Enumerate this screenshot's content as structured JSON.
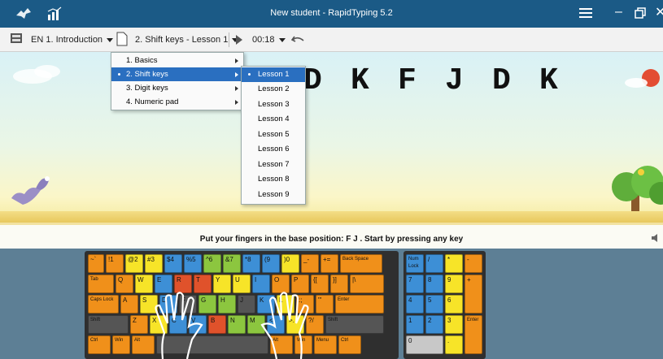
{
  "window": {
    "title": "New student - RapidTyping 5.2"
  },
  "toolbar": {
    "course": "EN 1. Introduction",
    "lesson": "2. Shift keys - Lesson 1",
    "timer": "00:18"
  },
  "menu_sections": {
    "items": [
      {
        "label": "1. Basics",
        "selected": false
      },
      {
        "label": "2. Shift keys",
        "selected": true
      },
      {
        "label": "3. Digit keys",
        "selected": false
      },
      {
        "label": "4. Numeric pad",
        "selected": false
      }
    ]
  },
  "menu_lessons": {
    "items": [
      {
        "label": "Lesson 1",
        "selected": true
      },
      {
        "label": "Lesson 2",
        "selected": false
      },
      {
        "label": "Lesson 3",
        "selected": false
      },
      {
        "label": "Lesson 4",
        "selected": false
      },
      {
        "label": "Lesson 5",
        "selected": false
      },
      {
        "label": "Lesson 6",
        "selected": false
      },
      {
        "label": "Lesson 7",
        "selected": false
      },
      {
        "label": "Lesson 8",
        "selected": false
      },
      {
        "label": "Lesson 9",
        "selected": false
      }
    ]
  },
  "exercise": {
    "letters": [
      "F",
      "J",
      "D",
      "K",
      "F",
      "J",
      "D",
      "K"
    ]
  },
  "instruction": "Put your fingers in the base position:  F  J .  Start by pressing any key",
  "keyboard": {
    "rows": [
      [
        "~`",
        "!1",
        "@2",
        "#3",
        "$4",
        "%5",
        "^6",
        "&7",
        "*8",
        "(9",
        ")0",
        "_-",
        "+=",
        "Back Space"
      ],
      [
        "Tab",
        "Q",
        "W",
        "E",
        "R",
        "T",
        "Y",
        "U",
        "I",
        "O",
        "P",
        "{[",
        "}]",
        "|\\"
      ],
      [
        "Caps Lock",
        "A",
        "S",
        "D",
        "F",
        "G",
        "H",
        "J",
        "K",
        "L",
        ":;",
        "\"'",
        "Enter"
      ],
      [
        "Shift",
        "Z",
        "X",
        "C",
        "V",
        "B",
        "N",
        "M",
        "<,",
        ">.",
        "?/",
        "Shift"
      ],
      [
        "Ctrl",
        "Win",
        "Alt",
        "",
        "Alt",
        "Win",
        "Menu",
        "Ctrl"
      ]
    ],
    "numpad": [
      "Num Lock",
      "/",
      "*",
      "-",
      "7",
      "8",
      "9",
      "+",
      "4",
      "5",
      "6",
      "1",
      "2",
      "3",
      "Enter",
      "0",
      "."
    ]
  },
  "colors": {
    "titlebar": "#1b5a86",
    "selection": "#2a6fc0",
    "orange": "#f0901a",
    "green": "#8cc63f",
    "blue": "#3d8fd6",
    "yellow": "#f7e428",
    "red": "#e0522b"
  }
}
